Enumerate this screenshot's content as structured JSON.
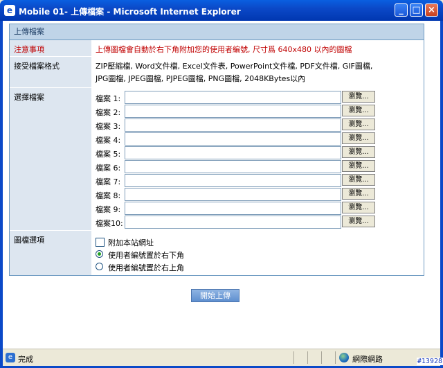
{
  "window": {
    "title": "Mobile 01- 上傳檔案 - Microsoft Internet Explorer",
    "icon": "ie-icon",
    "controls": [
      "_",
      "□",
      "×"
    ]
  },
  "panel": {
    "header": "上傳檔案",
    "notice_label": "注意事項",
    "notice_text": "上傳圖檔會自動於右下角附加您的使用者編號, 尺寸爲 640x480 以內的圖檔",
    "accepted_label": "接受檔案格式",
    "accepted_text_1": "ZIP壓縮檔, Word文件檔, Excel文件表, PowerPoint文件檔, PDF文件檔, GIF圖檔,",
    "accepted_text_2": "JPG圖檔, JPEG圖檔, PJPEG圖檔, PNG圖檔, 2048KBytes以內",
    "choose_label": "選擇檔案",
    "files": [
      {
        "label": "檔案 1:",
        "value": "",
        "button": "瀏覽..."
      },
      {
        "label": "檔案 2:",
        "value": "",
        "button": "瀏覽..."
      },
      {
        "label": "檔案 3:",
        "value": "",
        "button": "瀏覽..."
      },
      {
        "label": "檔案 4:",
        "value": "",
        "button": "瀏覽..."
      },
      {
        "label": "檔案 5:",
        "value": "",
        "button": "瀏覽..."
      },
      {
        "label": "檔案 6:",
        "value": "",
        "button": "瀏覽..."
      },
      {
        "label": "檔案 7:",
        "value": "",
        "button": "瀏覽..."
      },
      {
        "label": "檔案 8:",
        "value": "",
        "button": "瀏覽..."
      },
      {
        "label": "檔案 9:",
        "value": "",
        "button": "瀏覽..."
      },
      {
        "label": "檔案10:",
        "value": "",
        "button": "瀏覽..."
      }
    ],
    "options_label": "圖檔選項",
    "options": {
      "checkbox": {
        "label": "附加本站網址",
        "checked": false
      },
      "radio_bottom_right": {
        "label": "使用者編號置於右下角",
        "selected": true
      },
      "radio_top_right": {
        "label": "使用者編號置於右上角",
        "selected": false
      }
    }
  },
  "upload_button": "開始上傳",
  "statusbar": {
    "status": "完成",
    "zone": "網際網路"
  },
  "watermark": "#13928"
}
